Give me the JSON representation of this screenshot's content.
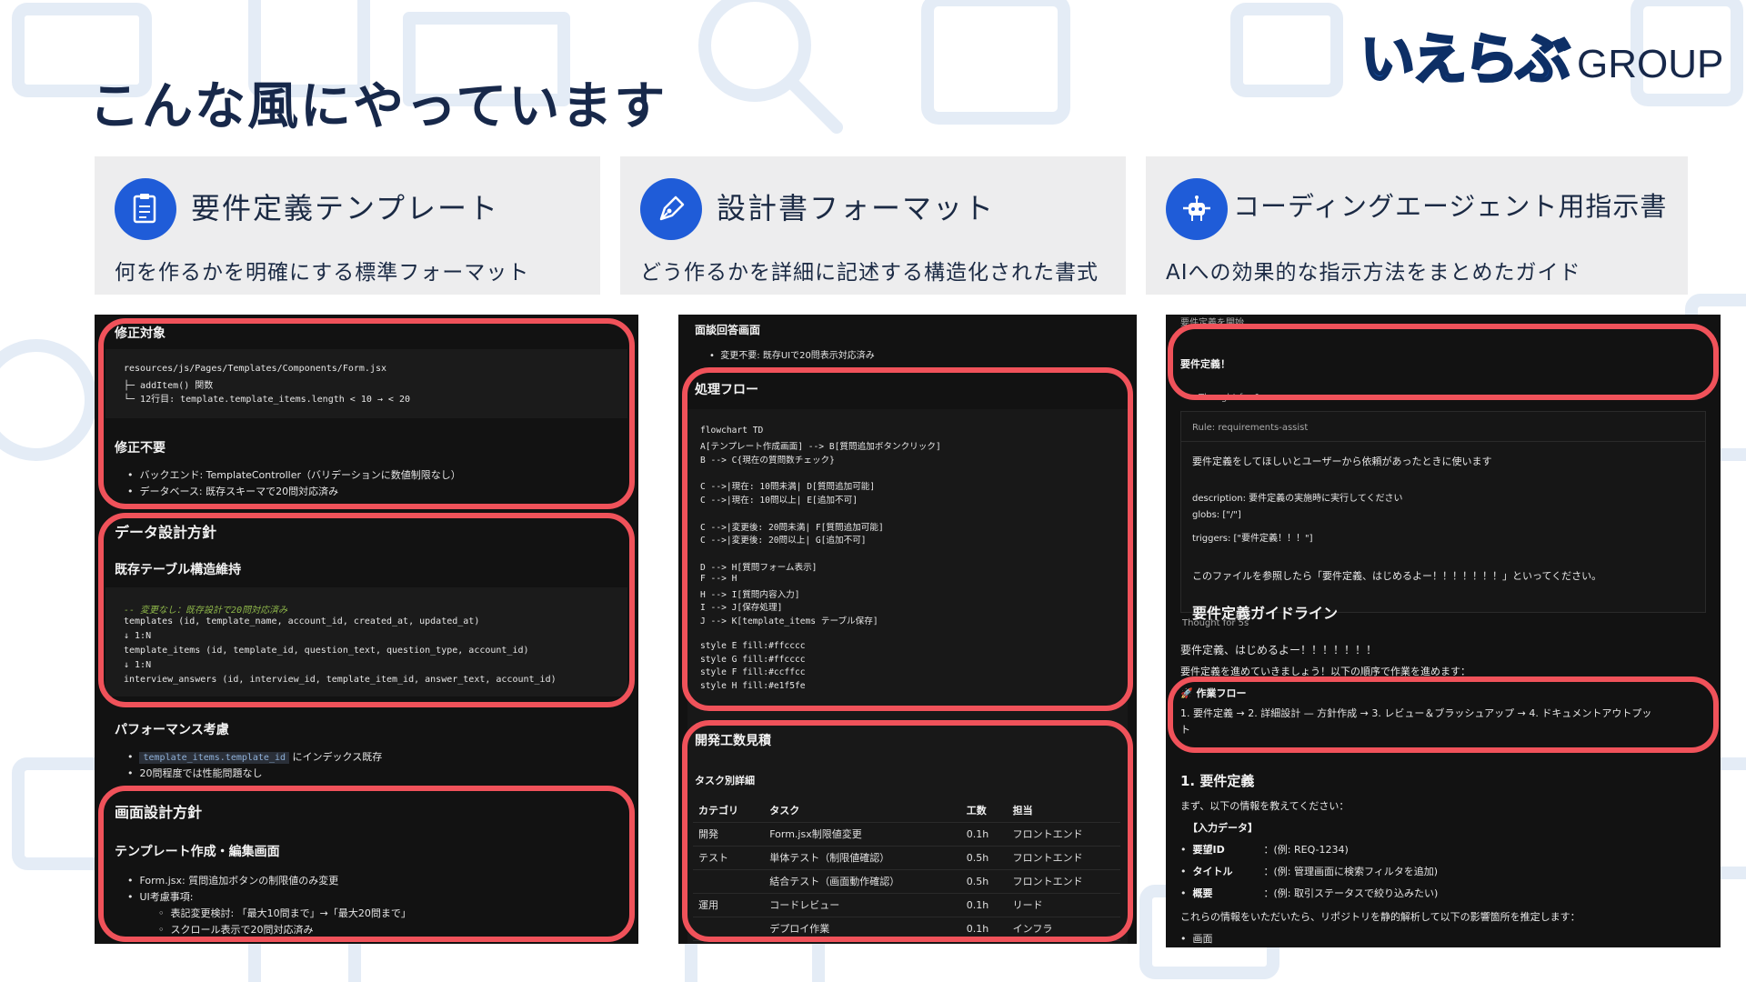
{
  "page": {
    "title": "こんな風にやっています",
    "logo_mark": "いえらぶ",
    "logo_group": "GROUP"
  },
  "cards": [
    {
      "title": "要件定義テンプレート",
      "desc": "何を作るかを明確にする標準フォーマット",
      "icon": "document-icon"
    },
    {
      "title": "設計書フォーマット",
      "desc": "どう作るかを詳細に記述する構造化された書式",
      "icon": "pen-icon"
    },
    {
      "title": "コーディングエージェント用指示書",
      "desc": "AIへの効果的な指示方法をまとめたガイド",
      "icon": "robot-icon"
    }
  ],
  "shot1": {
    "h_fix": "修正対象",
    "code1": [
      "resources/js/Pages/Templates/Components/Form.jsx",
      "├─ addItem() 関数",
      "└─ 12行目: template.template_items.length < 10 → < 20"
    ],
    "h_nochange": "修正不要",
    "bullets1": [
      "バックエンド: TemplateController（バリデーションに数値制限なし）",
      "データベース: 既存スキーマで20問対応済み"
    ],
    "h_data": "データ設計方針",
    "h_table": "既存テーブル構造維持",
    "code2_comment": "-- 変更なし：既存設計で20問対応済み",
    "code2": [
      "templates (id, template_name, account_id, created_at, updated_at)",
      "    ↓ 1:N",
      "template_items (id, template_id, question_text, question_type, account_id)",
      "    ↓ 1:N",
      "interview_answers (id, interview_id, template_item_id, answer_text, account_id)"
    ],
    "h_perf": "パフォーマンス考慮",
    "perf_code": "template_items.template_id",
    "perf_b1_rest": "にインデックス既存",
    "perf_b2": "20問程度では性能問題なし",
    "h_screen": "画面設計方針",
    "h_edit": "テンプレート作成・編集画面",
    "b_form": "Form.jsx: 質問追加ボタンの制限値のみ変更",
    "b_ui": "UI考慮事項:",
    "sub1": "表記変更検討: 「最大10問まで」→「最大20問まで」",
    "sub2": "スクロール表示で20問対応済み"
  },
  "shot2": {
    "h_answer": "面談回答画面",
    "b_answer": "変更不要: 既存UIで20問表示対応済み",
    "h_flow": "処理フロー",
    "flow": [
      "flowchart TD",
      "    A[テンプレート作成画面] --> B[質問追加ボタンクリック]",
      "    B --> C{現在の質問数チェック}",
      "",
      "    C -->|現在: 10問未満| D[質問追加可能]",
      "    C -->|現在: 10問以上| E[追加不可]",
      "",
      "    C -->|変更後: 20問未満| F[質問追加可能]",
      "    C -->|変更後: 20問以上| G[追加不可]",
      "",
      "    D --> H[質問フォーム表示]",
      "    F --> H",
      "    H --> I[質問内容入力]",
      "    I --> J[保存処理]",
      "    J --> K[template_items テーブル保存]",
      "",
      "    style E fill:#ffcccc",
      "    style G fill:#ffcccc",
      "    style F fill:#ccffcc",
      "    style H fill:#e1f5fe"
    ],
    "h_est": "開発工数見積",
    "h_task": "タスク別詳細",
    "table_head": [
      "カテゴリ",
      "タスク",
      "工数",
      "担当"
    ],
    "table_rows": [
      [
        "開発",
        "Form.jsx制限値変更",
        "0.1h",
        "フロントエンド"
      ],
      [
        "テスト",
        "単体テスト（制限値確認）",
        "0.5h",
        "フロントエンド"
      ],
      [
        "",
        "結合テスト（画面動作確認）",
        "0.5h",
        "フロントエンド"
      ],
      [
        "運用",
        "コードレビュー",
        "0.1h",
        "リード"
      ],
      [
        "",
        "デプロイ作業",
        "0.1h",
        "インフラ"
      ]
    ]
  },
  "shot3": {
    "top_cut": "要件定義を開始",
    "req": "要件定義！",
    "thought1": "Thought for 1s",
    "rule": "Rule: requirements-assist",
    "rule_text": "要件定義をしてほしいとユーザーから依頼があったときに使います",
    "desc": "description: 要件定義の実施時に実行してください",
    "globs": "globs: [\"/\"]",
    "triggers": "triggers: [\"要件定義！！！\"]",
    "file_ref": "このファイルを参照したら「要件定義、はじめるよー！！！！！！！」といってください。",
    "guideline_cut": "要件定義ガイドライン",
    "thought2": "Thought for 5s",
    "start": "要件定義、はじめるよー！！！！！！！",
    "proceed": "要件定義を進めていきましょう！以下の順序で作業を進めます：",
    "flow_h": "🚀 作業フロー",
    "flow_line1": "1. 要件定義 → 2. 詳細設計 — 方針作成 → 3. レビュー＆ブラッシュアップ → 4. ドキュメントアウトプッ",
    "flow_line2": "ト",
    "h_req": "1. 要件定義",
    "ask": "まず、以下の情報を教えてください：",
    "input_h": "【入力データ】",
    "inputs": [
      {
        "k": "要望ID",
        "v": "：(例: REQ-1234)"
      },
      {
        "k": "タイトル",
        "v": "：(例: 管理画面に検索フィルタを追加)"
      },
      {
        "k": "概要",
        "v": "：(例: 取引ステータスで絞り込みたい)"
      }
    ],
    "closing": "これらの情報をいただいたら、リポジトリを静的解析して以下の影響箇所を推定します：",
    "last": "画面"
  }
}
